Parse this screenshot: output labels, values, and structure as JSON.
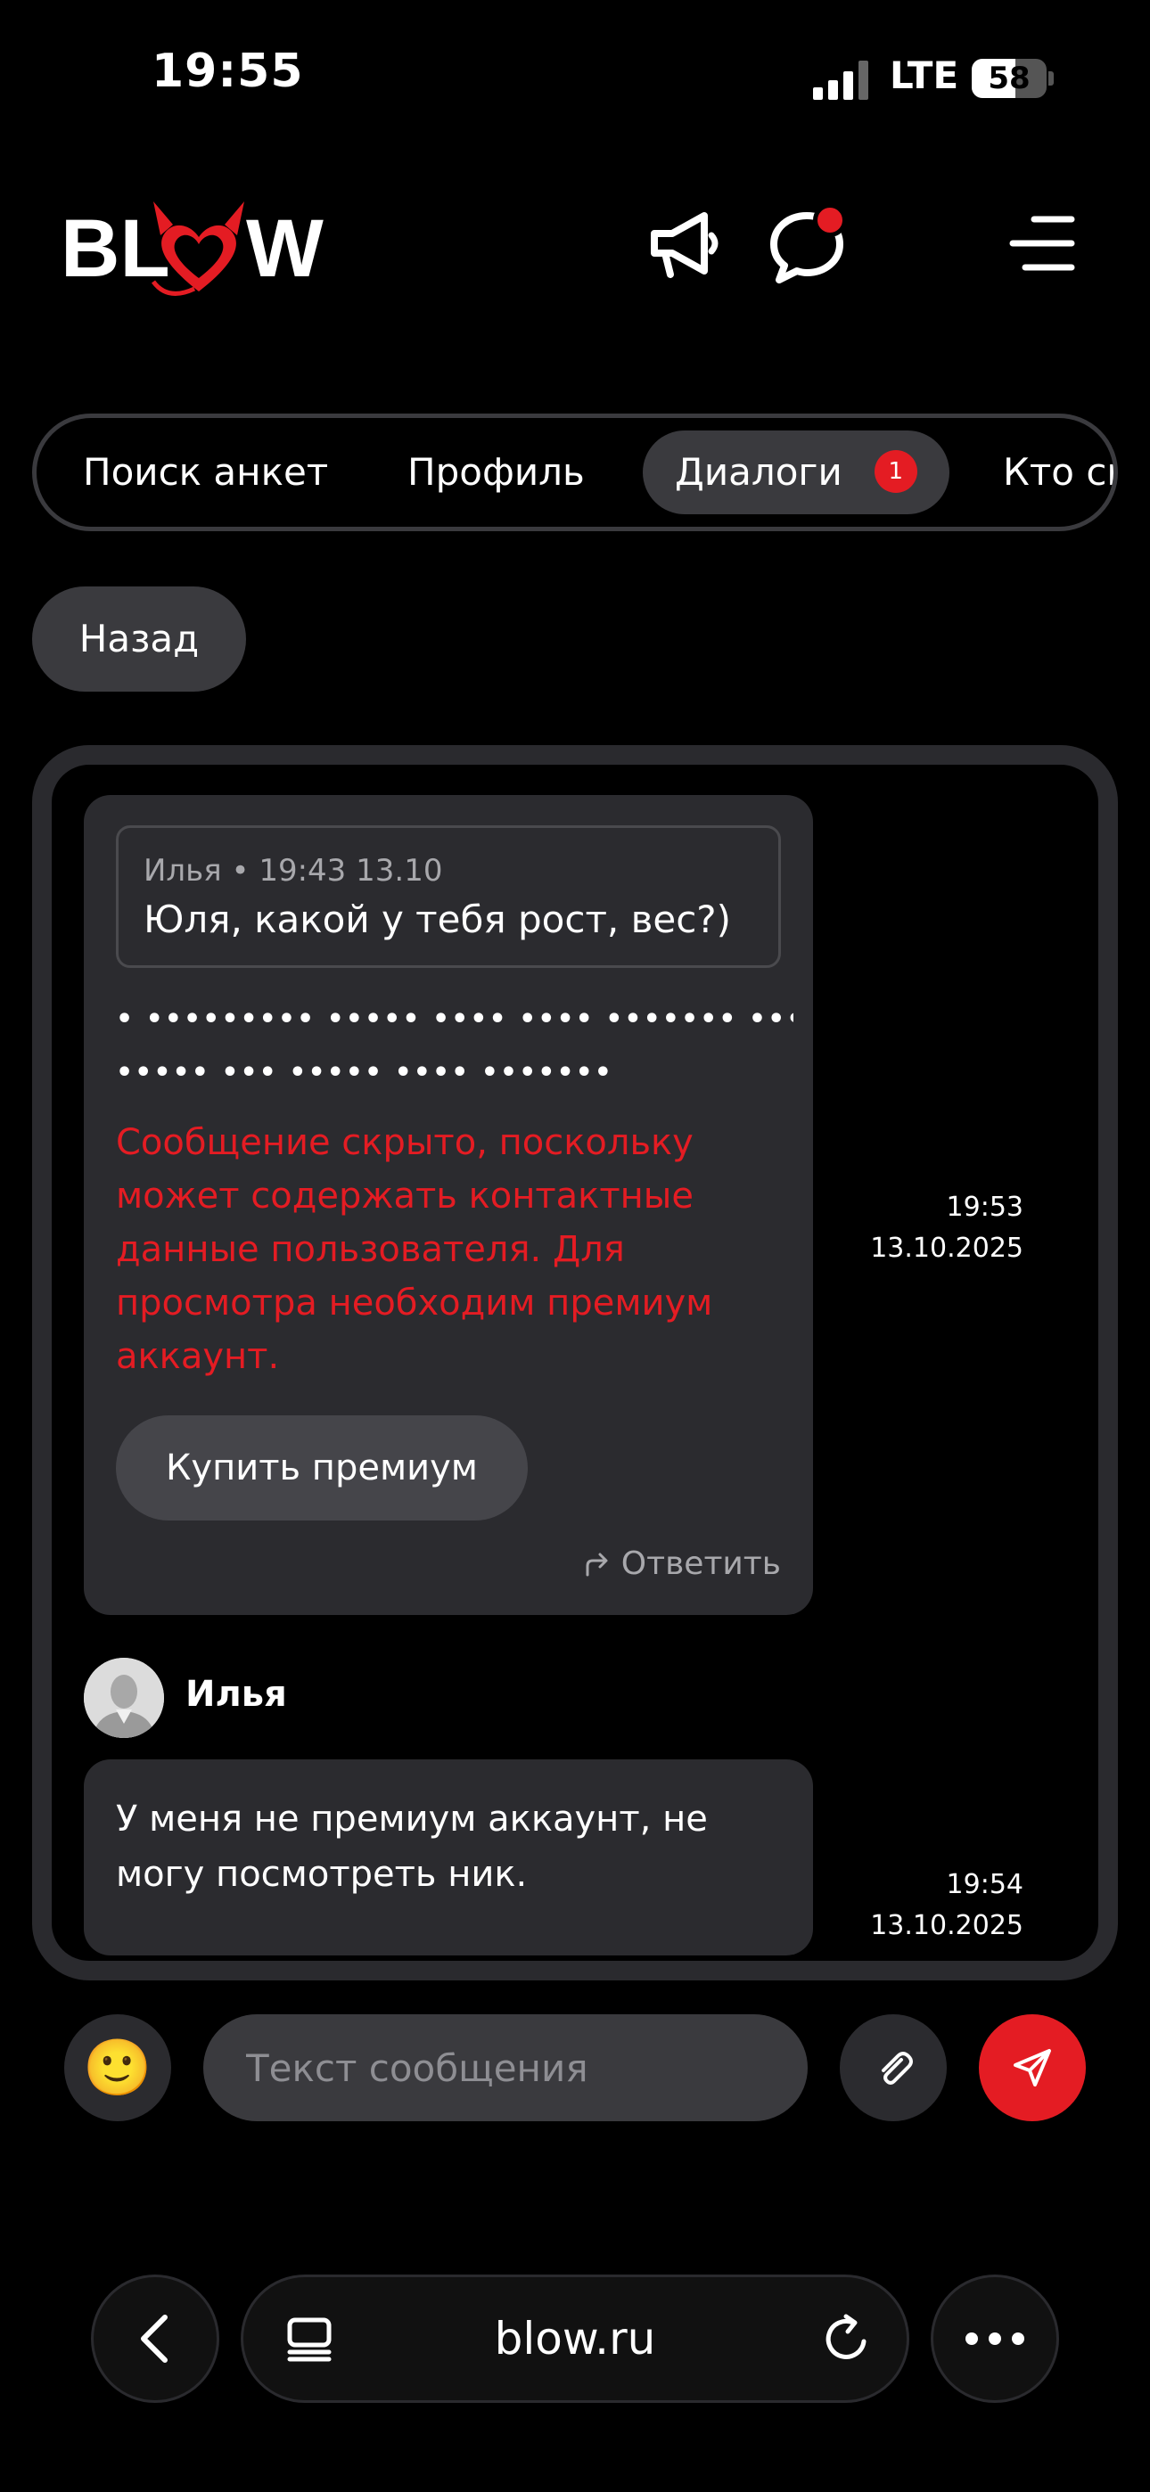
{
  "status_bar": {
    "time": "19:55",
    "network": "LTE",
    "battery_percent": "58",
    "battery_level": 0.58
  },
  "header": {
    "logo_text": "BLOW",
    "brand_color": "#e41c23",
    "icons": [
      "megaphone-icon",
      "chat-bubble-icon",
      "hamburger-menu-icon"
    ],
    "has_notification": true
  },
  "tabs": [
    {
      "label": "Поиск анкет",
      "active": false
    },
    {
      "label": "Профиль",
      "active": false
    },
    {
      "label": "Диалоги",
      "active": true,
      "badge": "1"
    },
    {
      "label": "Кто см",
      "active": false
    }
  ],
  "back_button": "Назад",
  "messages": [
    {
      "quote": {
        "meta": "Илья • 19:43 13.10",
        "text": "Юля, какой у тебя рост, вес?)"
      },
      "masked_line_1": "• ••••••••• ••••• •••• •••• ••••••• •••••••••• •• •••••••••",
      "masked_line_2": "••••• ••• ••••• •••• •••••••",
      "hidden_notice": "Сообщение скрыто, поскольку может содержать контактные данные пользователя. Для просмотра необходим премиум аккаунт.",
      "buy_button": "Купить премиум",
      "reply_label": "Ответить",
      "time": "19:53",
      "date": "13.10.2025"
    },
    {
      "sender": "Илья",
      "text": "У меня не премиум аккаунт, не могу посмотреть ник.",
      "time": "19:54",
      "date": "13.10.2025"
    }
  ],
  "composer": {
    "emoji": "🙂",
    "placeholder": "Текст сообщения"
  },
  "browser": {
    "url": "blow.ru"
  }
}
